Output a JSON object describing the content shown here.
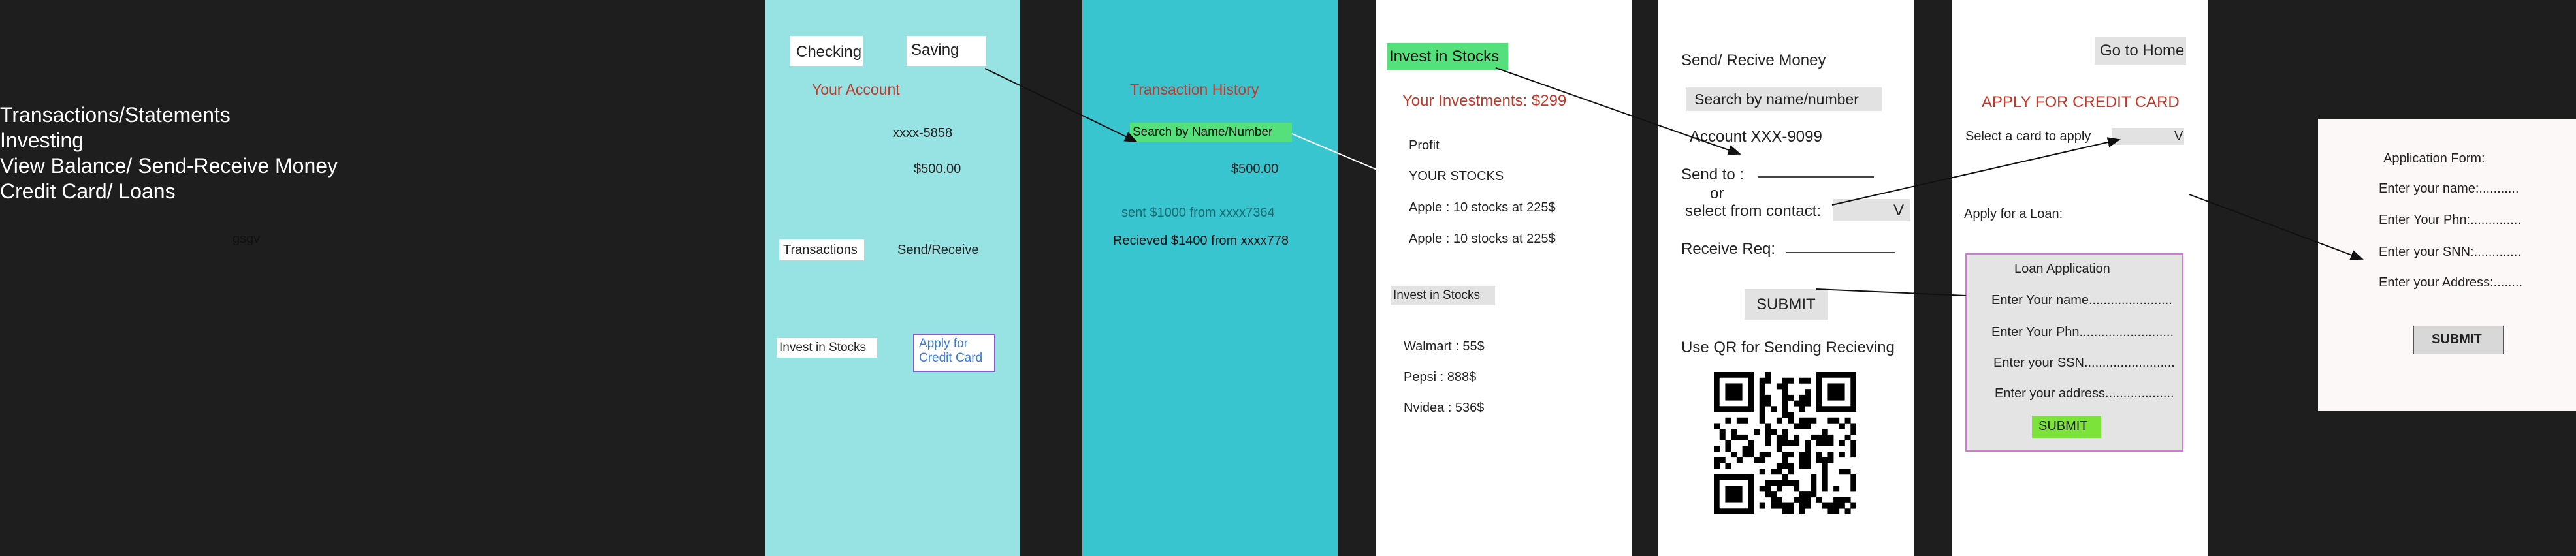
{
  "notes": {
    "lines": [
      "Transactions/Statements",
      "Investing",
      "View Balance/ Send-Receive Money",
      "Credit Card/ Loans"
    ],
    "scribble": "gsgv"
  },
  "frames": {
    "account": {
      "checking_tab": "Checking",
      "saving_tab": "Saving",
      "title": "Your Account",
      "account_number": "xxxx-5858",
      "balance": "$500.00",
      "transactions_button": "Transactions",
      "send_receive_link": "Send/Receive",
      "invest_button": "Invest in Stocks",
      "credit_card_button": "Apply for\nCredit Card"
    },
    "history": {
      "title": "Transaction History",
      "search_label": "Search by Name/Number",
      "balance": "$500.00",
      "tx1": "sent $1000 from xxxx7364",
      "tx2": "Recieved $1400 from xxxx778"
    },
    "invest": {
      "header": "Invest in Stocks",
      "investments": "Your Investments: $299",
      "profit": "Profit",
      "your_stocks": "YOUR STOCKS",
      "holdings": [
        "Apple : 10 stocks at 225$",
        "Apple : 10 stocks at 225$"
      ],
      "invest_button": "Invest in Stocks",
      "prices": [
        "Walmart : 55$",
        "Pepsi : 888$",
        "Nvidea : 536$"
      ]
    },
    "send": {
      "title": "Send/ Recive Money",
      "search_label": "Search by name/number",
      "account": "Account XXX-9099",
      "send_to": "Send to :",
      "or": "or",
      "select_contact": "select from contact:",
      "dropdown_value": "V",
      "receive_req": "Receive Req:",
      "submit": "SUBMIT",
      "qr_caption": "Use QR for Sending Recieving"
    },
    "credit": {
      "home_button": "Go to Home",
      "title": "APPLY FOR CREDIT CARD",
      "select_card": "Select a card to apply",
      "dropdown_value": "V",
      "apply_loan": "Apply for a Loan:",
      "loan_title": "Loan Application",
      "loan_fields": [
        "Enter Your name.......................",
        "Enter Your Phn..........................",
        "Enter your SSN.........................",
        "Enter your address..................."
      ],
      "loan_submit": "SUBMIT"
    },
    "form": {
      "title": "Application Form:",
      "fields": [
        "Enter your name:...........",
        "Enter Your Phn:..............",
        "Enter your SNN:.............",
        "Enter your Address:........"
      ],
      "submit": "SUBMIT"
    }
  },
  "colors": {
    "canvas": "#1e1e1e",
    "frame1": "#97e3e3",
    "frame2": "#38c5d0",
    "red_text": "#c0392b",
    "green_highlight": "#55e07c",
    "lime_button": "#7be33a",
    "form_bg": "#fbf8f7"
  }
}
